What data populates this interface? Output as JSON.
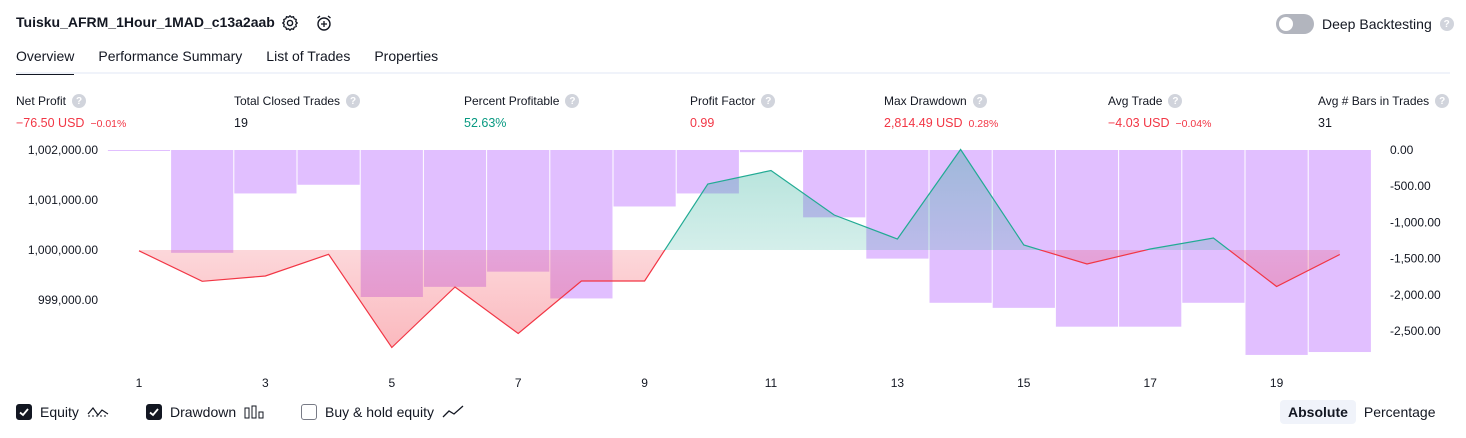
{
  "header": {
    "title": "Tuisku_AFRM_1Hour_1MAD_c13a2aab",
    "settings_icon": "gear-icon",
    "alert_icon": "alarm-plus-icon",
    "deep_backtesting_label": "Deep Backtesting",
    "deep_backtesting_on": false,
    "help_glyph": "?"
  },
  "tabs": [
    {
      "label": "Overview",
      "active": true
    },
    {
      "label": "Performance Summary",
      "active": false
    },
    {
      "label": "List of Trades",
      "active": false
    },
    {
      "label": "Properties",
      "active": false
    }
  ],
  "metrics": [
    {
      "label": "Net Profit",
      "value": "−76.50 USD",
      "pct": "−0.01%",
      "color": "#f23645"
    },
    {
      "label": "Total Closed Trades",
      "value": "19",
      "pct": "",
      "color": "#131722"
    },
    {
      "label": "Percent Profitable",
      "value": "52.63%",
      "pct": "",
      "color": "#089981"
    },
    {
      "label": "Profit Factor",
      "value": "0.99",
      "pct": "",
      "color": "#f23645"
    },
    {
      "label": "Max Drawdown",
      "value": "2,814.49 USD",
      "pct": "0.28%",
      "color": "#f23645"
    },
    {
      "label": "Avg Trade",
      "value": "−4.03 USD",
      "pct": "−0.04%",
      "color": "#f23645"
    },
    {
      "label": "Avg # Bars in Trades",
      "value": "31",
      "pct": "",
      "color": "#131722"
    }
  ],
  "legend": {
    "equity_label": "Equity",
    "equity_checked": true,
    "drawdown_label": "Drawdown",
    "drawdown_checked": true,
    "buyhold_label": "Buy & hold equity",
    "buyhold_checked": false
  },
  "view_toggle": {
    "absolute_label": "Absolute",
    "percentage_label": "Percentage",
    "selected": "Absolute"
  },
  "chart_data": {
    "type": "line",
    "x_ticks": [
      "1",
      "3",
      "5",
      "7",
      "9",
      "11",
      "13",
      "15",
      "17",
      "19"
    ],
    "equity": {
      "x": [
        1,
        2,
        3,
        4,
        5,
        6,
        7,
        8,
        9,
        10,
        11,
        12,
        13,
        14,
        15,
        16,
        17,
        18,
        19,
        20
      ],
      "values": [
        999985,
        999375,
        999480,
        999915,
        998050,
        999260,
        998330,
        999380,
        999380,
        1001320,
        1001590,
        1000700,
        1000220,
        1002010,
        1000100,
        999720,
        1000020,
        1000240,
        999270,
        999910
      ],
      "baseline": 1000000,
      "above_color": "#22ab94",
      "below_color": "#f23645"
    },
    "drawdown": {
      "x": [
        1,
        2,
        3,
        4,
        5,
        6,
        7,
        8,
        9,
        10,
        11,
        12,
        13,
        14,
        15,
        16,
        17,
        18,
        19,
        20
      ],
      "values": [
        -10,
        -1420,
        -600,
        -480,
        -2030,
        -1890,
        -1680,
        -2050,
        -780,
        -600,
        -30,
        -930,
        -1500,
        -2110,
        -2180,
        -2440,
        -2440,
        -2110,
        -2830,
        -2790
      ],
      "color": "#e1bfff"
    },
    "left_axis": {
      "ticks": [
        "1,002,000.00",
        "1,001,000.00",
        "1,000,000.00",
        "999,000.00"
      ],
      "min": 997800,
      "max": 1002000
    },
    "right_axis": {
      "ticks": [
        "0.00",
        "-500.00",
        "-1,000.00",
        "-1,500.00",
        "-2,000.00",
        "-2,500.00"
      ],
      "min": -2900,
      "max": 0
    },
    "colors": {
      "equity_positive": "#22ab94",
      "equity_negative": "#f23645",
      "drawdown": "#e1bfff",
      "grid": "#f0f3fa",
      "axis_text": "#131722"
    }
  }
}
